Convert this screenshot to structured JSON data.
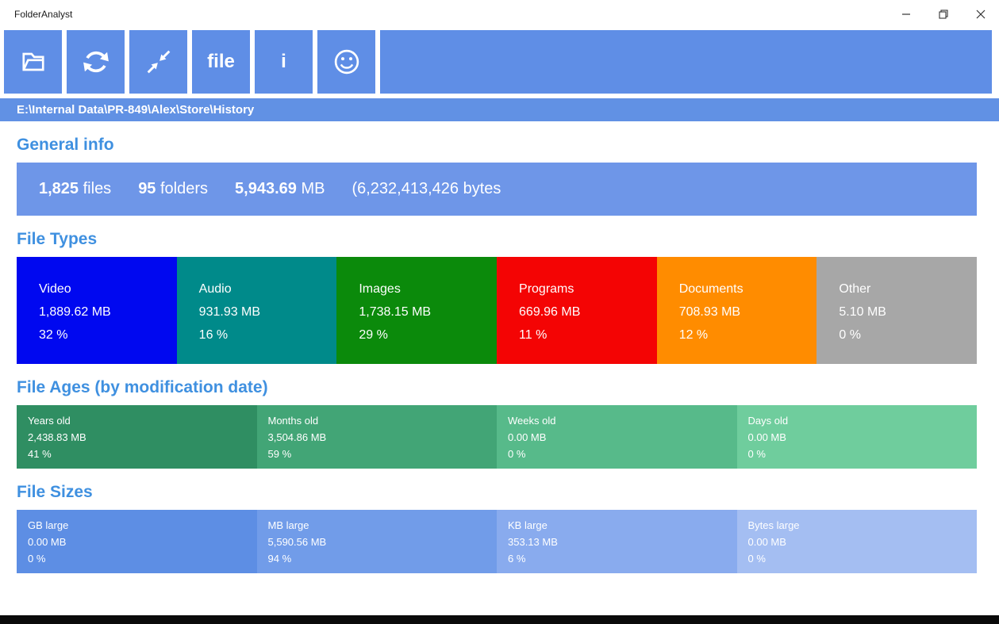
{
  "window": {
    "title": "FolderAnalyst",
    "controls": [
      {
        "icon": "minimize-icon"
      },
      {
        "icon": "restore-icon"
      },
      {
        "icon": "close-icon"
      }
    ]
  },
  "toolbar": {
    "buttons": [
      {
        "name": "open-folder",
        "icon": "folder-icon"
      },
      {
        "name": "refresh",
        "icon": "refresh-icon"
      },
      {
        "name": "collapse",
        "icon": "arrows-inward-icon"
      },
      {
        "name": "file",
        "label": "file"
      },
      {
        "name": "info",
        "label": "i"
      },
      {
        "name": "about",
        "icon": "smiley-icon"
      }
    ]
  },
  "path": "E:\\Internal Data\\PR-849\\Alex\\Store\\History",
  "general_info": {
    "heading": "General info",
    "files_value": "1,825",
    "files_label": " files",
    "folders_value": "95",
    "folders_label": " folders",
    "size_value": "5,943.69",
    "size_label": " MB",
    "bytes": "(6,232,413,426 bytes"
  },
  "file_types": {
    "heading": "File Types",
    "items": [
      {
        "label": "Video",
        "size": "1,889.62 MB",
        "pct": "32 %",
        "color": "#0008f0"
      },
      {
        "label": "Audio",
        "size": "931.93 MB",
        "pct": "16 %",
        "color": "#008a8a"
      },
      {
        "label": "Images",
        "size": "1,738.15 MB",
        "pct": "29 %",
        "color": "#0b8a0b"
      },
      {
        "label": "Programs",
        "size": "669.96 MB",
        "pct": "11 %",
        "color": "#f40404"
      },
      {
        "label": "Documents",
        "size": "708.93 MB",
        "pct": "12 %",
        "color": "#ff8c00"
      },
      {
        "label": "Other",
        "size": "5.10 MB",
        "pct": "0 %",
        "color": "#a7a7a7"
      }
    ]
  },
  "file_ages": {
    "heading": "File Ages (by modification date)",
    "items": [
      {
        "label": "Years old",
        "size": "2,438.83 MB",
        "pct": "41 %",
        "color": "#2f8e62"
      },
      {
        "label": "Months old",
        "size": "3,504.86 MB",
        "pct": "59 %",
        "color": "#42a576"
      },
      {
        "label": "Weeks old",
        "size": "0.00 MB",
        "pct": "0 %",
        "color": "#57ba8a"
      },
      {
        "label": "Days old",
        "size": "0.00 MB",
        "pct": "0 %",
        "color": "#6fcd9d"
      }
    ]
  },
  "file_sizes": {
    "heading": "File Sizes",
    "items": [
      {
        "label": "GB large",
        "size": "0.00 MB",
        "pct": "0 %",
        "color": "#5d8ee4"
      },
      {
        "label": "MB large",
        "size": "5,590.56 MB",
        "pct": "94 %",
        "color": "#719ce9"
      },
      {
        "label": "KB large",
        "size": "353.13 MB",
        "pct": "6 %",
        "color": "#89abee"
      },
      {
        "label": "Bytes large",
        "size": "0.00 MB",
        "pct": "0 %",
        "color": "#a4bef2"
      }
    ]
  }
}
